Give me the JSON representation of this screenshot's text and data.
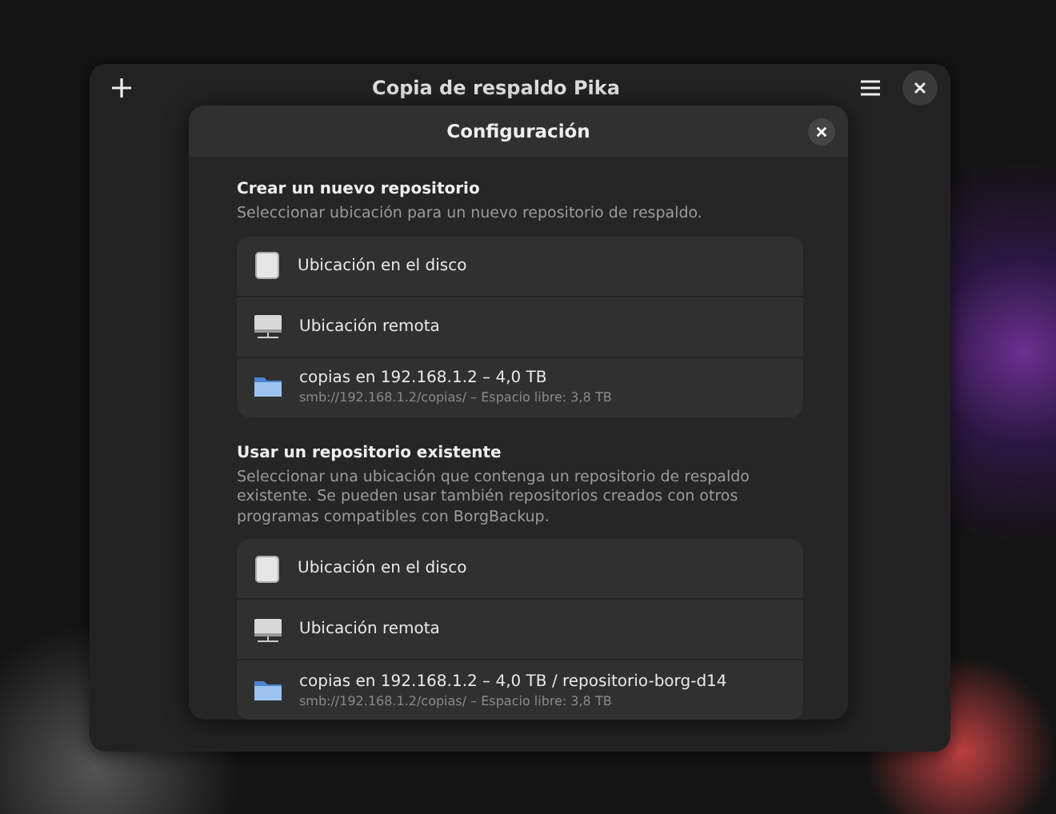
{
  "window": {
    "title": "Copia de respaldo Pika"
  },
  "dialog": {
    "title": "Configuración",
    "sections": [
      {
        "title": "Crear un nuevo repositorio",
        "description": "Seleccionar ubicación para un nuevo repositorio de respaldo.",
        "rows": [
          {
            "kind": "disk",
            "title": "Ubicación en el disco"
          },
          {
            "kind": "remote",
            "title": "Ubicación remota"
          },
          {
            "kind": "folder",
            "title": "copias en 192.168.1.2 – 4,0 TB",
            "subtitle": "smb://192.168.1.2/copias/ – Espacio libre: 3,8 TB"
          }
        ]
      },
      {
        "title": "Usar un repositorio existente",
        "description": "Seleccionar una ubicación que contenga un repositorio de respaldo existente. Se pueden usar también repositorios creados con otros programas compatibles con BorgBackup.",
        "rows": [
          {
            "kind": "disk",
            "title": "Ubicación en el disco"
          },
          {
            "kind": "remote",
            "title": "Ubicación remota"
          },
          {
            "kind": "folder",
            "title": "copias en 192.168.1.2 – 4,0 TB / repositorio-borg-d14",
            "subtitle": "smb://192.168.1.2/copias/ – Espacio libre: 3,8 TB"
          }
        ]
      }
    ]
  }
}
